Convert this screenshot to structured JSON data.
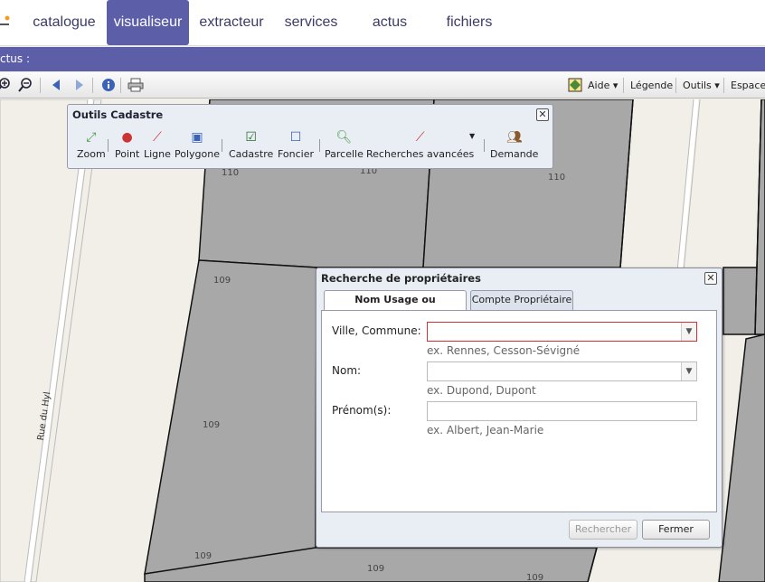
{
  "nav": {
    "tabs": [
      {
        "label": "catalogue",
        "active": false
      },
      {
        "label": "visualiseur",
        "active": true
      },
      {
        "label": "extracteur",
        "active": false
      },
      {
        "label": "services",
        "active": false
      },
      {
        "label": "actus",
        "active": false
      },
      {
        "label": "fichiers",
        "active": false
      }
    ]
  },
  "band": {
    "text": "ctus :"
  },
  "toolbar": {
    "aide": "Aide ▾",
    "legende": "Légende",
    "outils": "Outils ▾",
    "espace": "Espace"
  },
  "map": {
    "street_label": "Rue du Hyl",
    "parcel_numbers": [
      "110",
      "110",
      "110",
      "109",
      "109",
      "109",
      "109",
      "109"
    ]
  },
  "cadastre": {
    "title": "Outils Cadastre",
    "tools": [
      "Zoom",
      "Point",
      "Ligne",
      "Polygone",
      "Cadastre",
      "Foncier",
      "Parcelle",
      "Recherches avancées",
      "Demande"
    ]
  },
  "dialog": {
    "title": "Recherche de propriétaires",
    "tabs": [
      "Nom Usage ou Naissance",
      "Compte Propriétaire"
    ],
    "fields": {
      "ville_label": "Ville, Commune:",
      "ville_value": "",
      "ville_hint": "ex. Rennes, Cesson-Sévigné",
      "nom_label": "Nom:",
      "nom_value": "",
      "nom_hint": "ex. Dupond, Dupont",
      "prenom_label": "Prénom(s):",
      "prenom_value": "",
      "prenom_hint": "ex. Albert, Jean-Marie"
    },
    "buttons": {
      "search": "Rechercher",
      "close": "Fermer"
    }
  },
  "colors": {
    "accent": "#5c5fa8",
    "parcel": "#a8a8a8",
    "road": "#f2efe9"
  }
}
